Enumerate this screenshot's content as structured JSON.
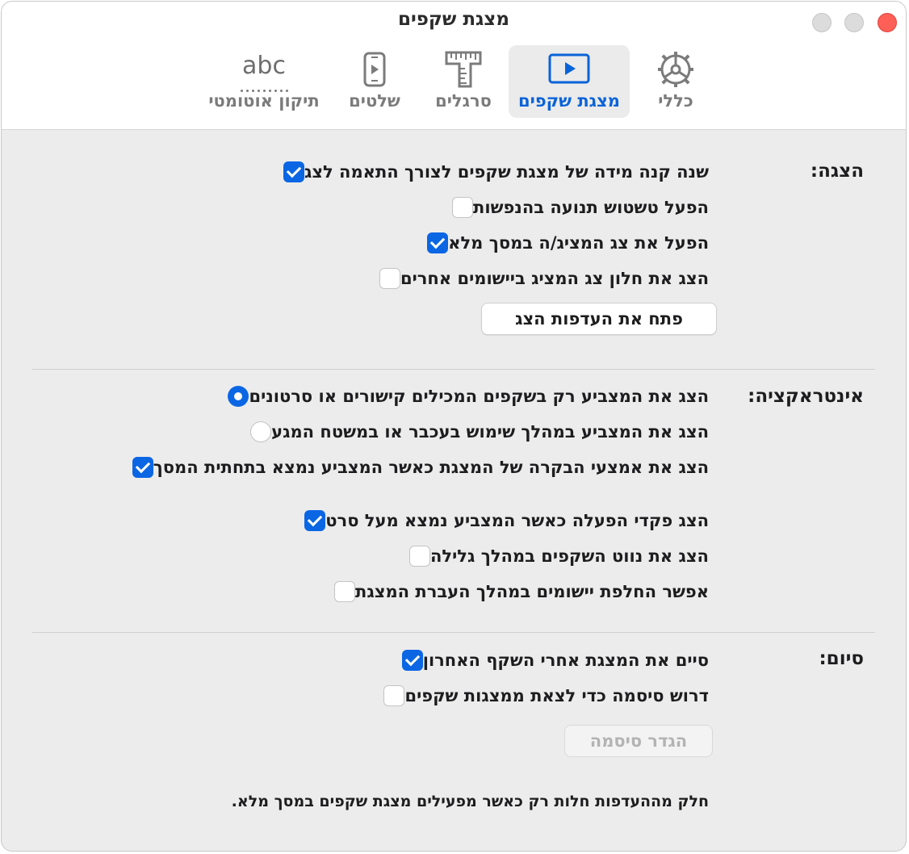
{
  "window": {
    "title": "מצגת שקפים"
  },
  "tabs": [
    {
      "label": "כללי",
      "icon": "gear-icon",
      "selected": false
    },
    {
      "label": "מצגת שקפים",
      "icon": "play-slideshow-icon",
      "selected": true
    },
    {
      "label": "סרגלים",
      "icon": "ruler-icon",
      "selected": false
    },
    {
      "label": "שלטים",
      "icon": "remote-icon",
      "selected": false
    },
    {
      "label": "תיקון אוטומטי",
      "icon": "abc-autocorrect-icon",
      "icon_text": "abc",
      "selected": false
    }
  ],
  "display": {
    "label": "הצגה:",
    "options": [
      {
        "text": "שנה קנה מידה של מצגת שקפים לצורך התאמה לצג",
        "checked": true
      },
      {
        "text": "הפעל טשטוש תנועה בהנפשות",
        "checked": false
      },
      {
        "text": "הפעל את צג המציג/ה במסך מלא",
        "checked": true
      },
      {
        "text": "הצג את חלון צג המציג ביישומים אחרים",
        "checked": false
      }
    ],
    "button_label": "פתח את העדפות הצג"
  },
  "interaction": {
    "label": "אינטראקציה:",
    "radios": [
      {
        "text": "הצג את המצביע רק בשקפים המכילים קישורים או סרטונים",
        "selected": true
      },
      {
        "text": "הצג את המצביע במהלך שימוש בעכבר או במשטח המגע",
        "selected": false
      }
    ],
    "checkboxes": [
      {
        "text": "הצג את אמצעי הבקרה של המצגת כאשר המצביע נמצא בתחתית המסך",
        "checked": true
      },
      {
        "text": "הצג פקדי הפעלה כאשר המצביע נמצא מעל סרט",
        "checked": true
      },
      {
        "text": "הצג את נווט השקפים במהלך גלילה",
        "checked": false
      },
      {
        "text": "אפשר החלפת יישומים במהלך העברת המצגת",
        "checked": false
      }
    ]
  },
  "end": {
    "label": "סיום:",
    "options": [
      {
        "text": "סיים את המצגת אחרי השקף האחרון",
        "checked": true
      },
      {
        "text": "דרוש סיסמה כדי לצאת ממצגות שקפים",
        "checked": false
      }
    ],
    "button_label": "הגדר סיסמה"
  },
  "footnote": "חלק מההעדפות חלות רק כאשר מפעילים מצגת שקפים במסך מלא."
}
